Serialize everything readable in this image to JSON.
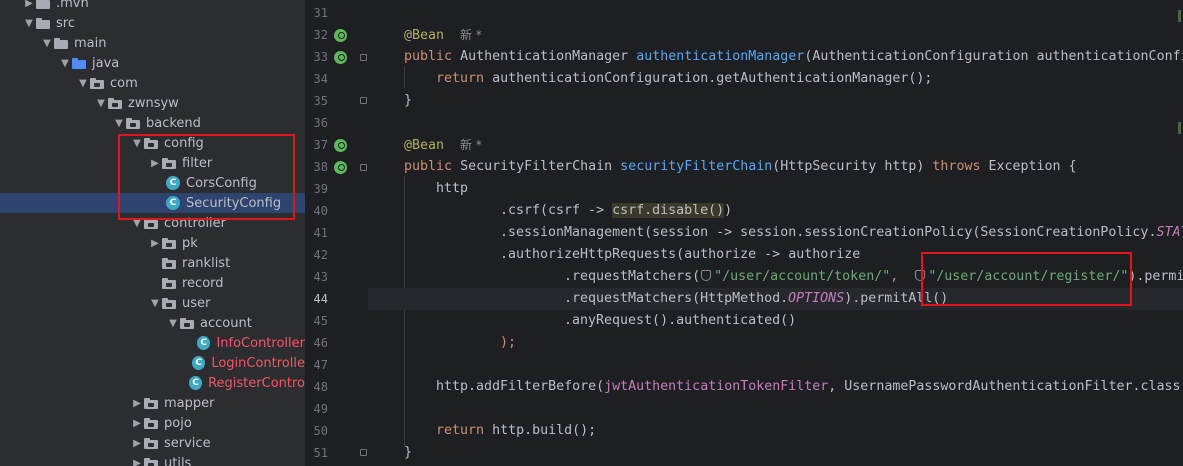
{
  "tree": {
    "items": [
      {
        "label": ".mvn"
      },
      {
        "label": "src"
      },
      {
        "label": "main"
      },
      {
        "label": "java"
      },
      {
        "label": "com"
      },
      {
        "label": "zwnsyw"
      },
      {
        "label": "backend"
      },
      {
        "label": "config"
      },
      {
        "label": "filter"
      },
      {
        "label": "CorsConfig"
      },
      {
        "label": "SecurityConfig"
      },
      {
        "label": "controller"
      },
      {
        "label": "pk"
      },
      {
        "label": "ranklist"
      },
      {
        "label": "record"
      },
      {
        "label": "user"
      },
      {
        "label": "account"
      },
      {
        "label": "InfoController"
      },
      {
        "label": "LoginControlle"
      },
      {
        "label": "RegisterContro"
      },
      {
        "label": "mapper"
      },
      {
        "label": "pojo"
      },
      {
        "label": "service"
      },
      {
        "label": "utils"
      }
    ],
    "class_icon_letter": "C"
  },
  "editor": {
    "line_numbers": [
      "31",
      "32",
      "33",
      "34",
      "35",
      "36",
      "37",
      "38",
      "39",
      "40",
      "41",
      "42",
      "43",
      "44",
      "45",
      "46",
      "47",
      "48",
      "49",
      "50",
      "51"
    ],
    "tokens": {
      "bean": "@Bean",
      "new_hint": "新 *",
      "public": "public",
      "return": "return",
      "throws": "throws",
      "am_type": "AuthenticationManager",
      "am_method": "authenticationManager",
      "am_params": "(AuthenticationConfiguration authenticationConfi",
      "am_return": "authenticationConfiguration.getAuthenticationManager();",
      "close_brace": "}",
      "sfc_type": "SecurityFilterChain",
      "sfc_method": "securityFilterChain",
      "sfc_params": "(HttpSecurity http)",
      "exception": "Exception {",
      "http": "http",
      "csrf_pre": ".csrf(csrf -> ",
      "csrf_hl": "csrf.disable()",
      "csrf_post": ")",
      "session_pre": ".sessionManagement(session -> session.sessionCreationPolicy(SessionCreationPolicy.",
      "session_const": "STAT",
      "authorize": ".authorizeHttpRequests(authorize -> authorize",
      "req1": ".requestMatchers(",
      "str1": "\"/user/account/token/\"",
      "comma": ", ",
      "str2": "\"/user/account/register/\"",
      "permit_cut": ").permi",
      "req2_pre": ".requestMatchers(HttpMethod.",
      "options": "OPTIONS",
      "req2_post": ").permitAll()",
      "any": ".anyRequest().authenticated()",
      "close_paren": ");",
      "filter_pre": "http.addFilterBefore(",
      "filter_field": "jwtAuthenticationTokenFilter",
      "filter_post": ", UsernamePasswordAuthenticationFilter.class)",
      "build": "http.build();"
    }
  }
}
